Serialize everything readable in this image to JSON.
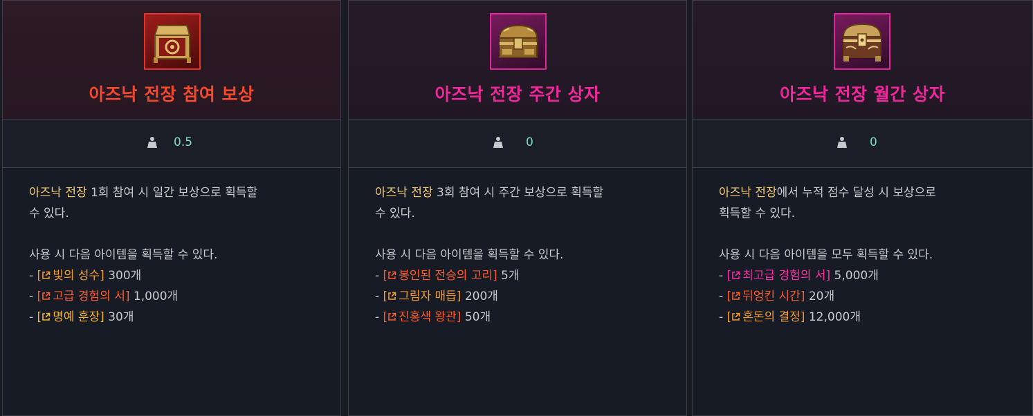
{
  "colors": {
    "title_red": "#f2492f",
    "title_pink": "#f0289b",
    "stat_teal": "#7ddcc9",
    "highlight_gold": "#f4cc73",
    "link_red": "#ff5a2b",
    "link_orange": "#f39a31",
    "link_pink": "#ff2ca4",
    "link_yellow": "#f4b43d"
  },
  "cards": [
    {
      "icon": "red-treasure-chest-icon",
      "title": "아즈낙 전장 참여 보상",
      "weight": "0.5",
      "desc_highlight": "아즈낙 전장",
      "desc_line1_rest": " 1회 참여 시 일간 보상으로 획득할",
      "desc_line2": "수 있다.",
      "use_line": "사용 시 다음 아이템을 획득할 수 있다.",
      "items": [
        {
          "name": "빛의 성수",
          "qty": "300개",
          "color": "orange"
        },
        {
          "name": "고급 경험의 서",
          "qty": "1,000개",
          "color": "red"
        },
        {
          "name": "명예 훈장",
          "qty": "30개",
          "color": "yellow"
        }
      ]
    },
    {
      "icon": "golden-chest-icon",
      "title": "아즈낙 전장 주간 상자",
      "weight": "0",
      "desc_highlight": "아즈낙 전장",
      "desc_line1_rest": " 3회 참여 시 주간 보상으로 획득할",
      "desc_line2": "수 있다.",
      "use_line": "사용 시 다음 아이템을 획득할 수 있다.",
      "items": [
        {
          "name": "봉인된 전승의 고리",
          "qty": "5개",
          "color": "red"
        },
        {
          "name": "그림자 매듭",
          "qty": "200개",
          "color": "orange"
        },
        {
          "name": "진홍색 왕관",
          "qty": "50개",
          "color": "red"
        }
      ]
    },
    {
      "icon": "ornate-chest-icon",
      "title": "아즈낙 전장 월간 상자",
      "weight": "0",
      "desc_highlight": "아즈낙 전장",
      "desc_line1_rest": "에서 누적 점수 달성 시 보상으로",
      "desc_line2": "획득할 수 있다.",
      "use_line": "사용 시 다음 아이템을 모두 획득할 수 있다.",
      "items": [
        {
          "name": "최고급 경험의 서",
          "qty": "5,000개",
          "color": "pink"
        },
        {
          "name": "뒤엉킨 시간",
          "qty": "20개",
          "color": "red"
        },
        {
          "name": "혼돈의 결정",
          "qty": "12,000개",
          "color": "orange"
        }
      ]
    }
  ]
}
